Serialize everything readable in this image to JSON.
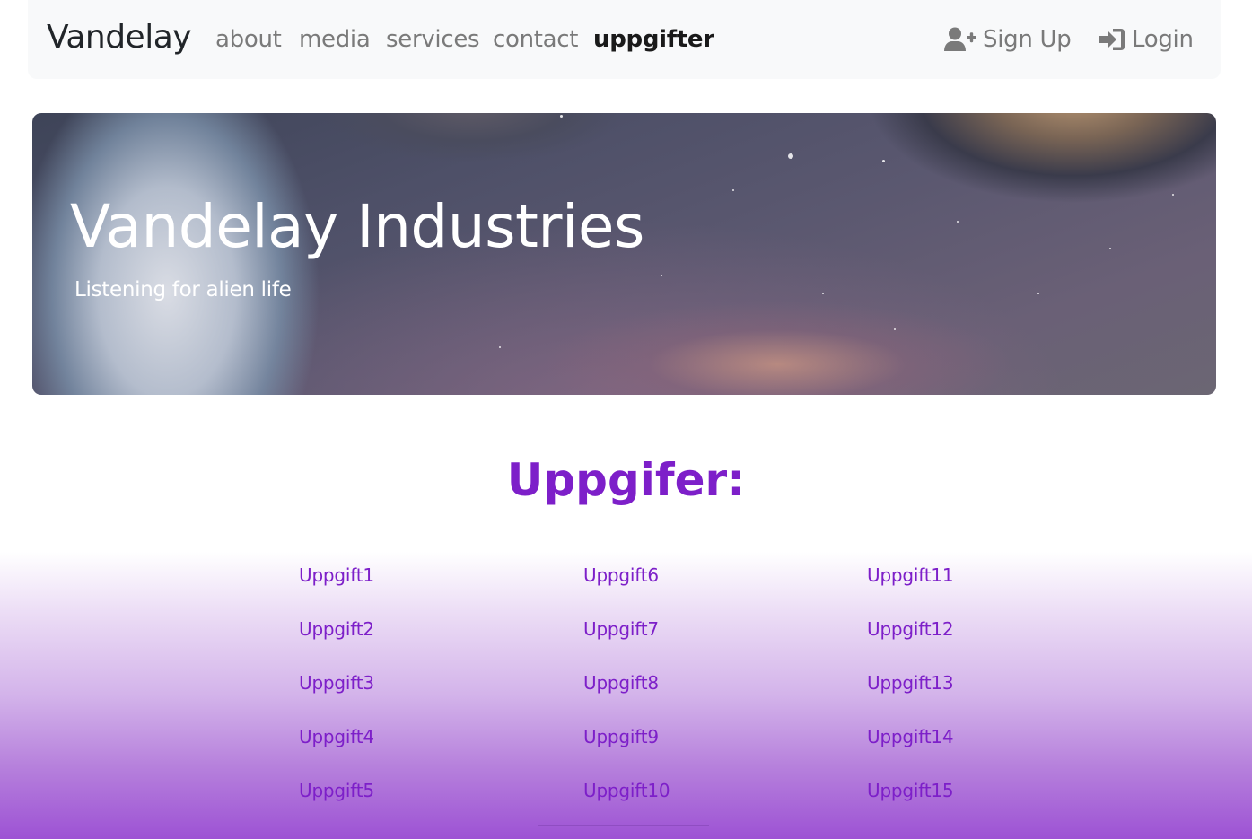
{
  "colors": {
    "accent": "#7d1fc9",
    "navbar_bg": "#f8f9fa",
    "nav_text": "#7a7a7a",
    "nav_active": "#1a1a1a",
    "gradient_bottom": "#9d52d4"
  },
  "navbar": {
    "brand": "Vandelay",
    "links": [
      {
        "label": "about"
      },
      {
        "label": "media"
      },
      {
        "label": "services"
      },
      {
        "label": "contact"
      },
      {
        "label": "uppgifter",
        "active": true
      }
    ],
    "signup": {
      "label": "Sign Up",
      "icon": "user-plus-icon"
    },
    "login": {
      "label": "Login",
      "icon": "sign-in-icon"
    }
  },
  "hero": {
    "title": "Vandelay Industries",
    "subtitle": "Listening for alien life"
  },
  "tasks": {
    "heading": "Uppgifer:",
    "items": [
      "Uppgift1",
      "Uppgift2",
      "Uppgift3",
      "Uppgift4",
      "Uppgift5",
      "Uppgift6",
      "Uppgift7",
      "Uppgift8",
      "Uppgift9",
      "Uppgift10",
      "Uppgift11",
      "Uppgift12",
      "Uppgift13",
      "Uppgift14",
      "Uppgift15"
    ]
  }
}
